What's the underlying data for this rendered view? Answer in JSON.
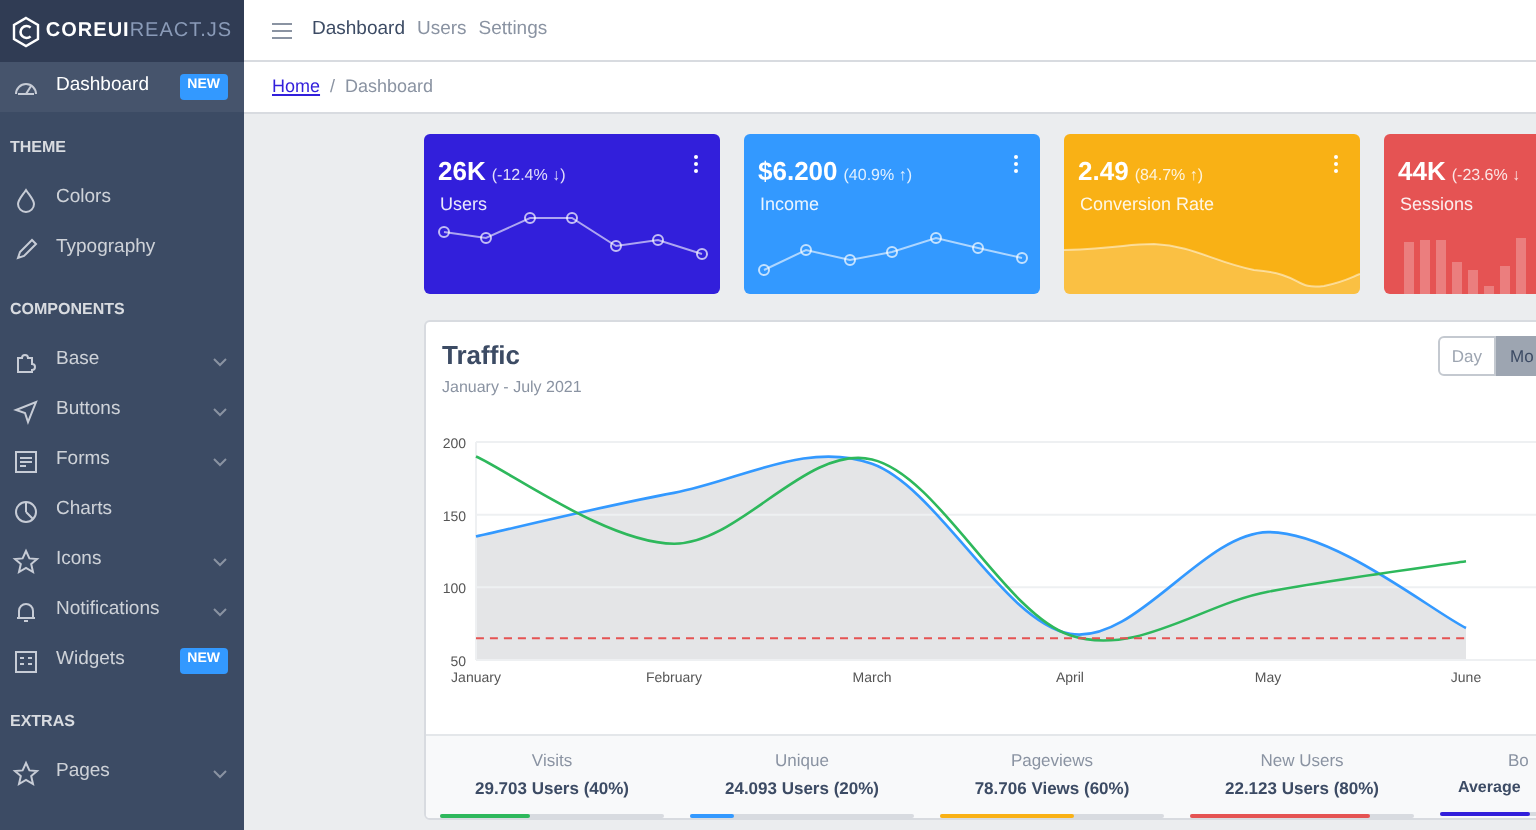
{
  "sidebar": {
    "brand": {
      "bold": "COREUI",
      "light": "REACT.JS"
    },
    "items": [
      {
        "kind": "link",
        "label": "Dashboard",
        "selected": true,
        "dropdown": false,
        "badge": "NEW"
      },
      {
        "kind": "title",
        "label": "THEME"
      },
      {
        "kind": "link",
        "label": "Colors",
        "selected": false,
        "dropdown": false
      },
      {
        "kind": "link",
        "label": "Typography",
        "selected": false,
        "dropdown": false
      },
      {
        "kind": "title",
        "label": "COMPONENTS"
      },
      {
        "kind": "link",
        "label": "Base",
        "selected": false,
        "dropdown": true
      },
      {
        "kind": "link",
        "label": "Buttons",
        "selected": false,
        "dropdown": true
      },
      {
        "kind": "link",
        "label": "Forms",
        "selected": false,
        "dropdown": true
      },
      {
        "kind": "link",
        "label": "Charts",
        "selected": false,
        "dropdown": false
      },
      {
        "kind": "link",
        "label": "Icons",
        "selected": false,
        "dropdown": true
      },
      {
        "kind": "link",
        "label": "Notifications",
        "selected": false,
        "dropdown": true
      },
      {
        "kind": "link",
        "label": "Widgets",
        "selected": false,
        "dropdown": false,
        "badge": "NEW"
      },
      {
        "kind": "title",
        "label": "EXTRAS"
      },
      {
        "kind": "link",
        "label": "Pages",
        "selected": false,
        "dropdown": true
      }
    ]
  },
  "header": {
    "nav": [
      {
        "label": "Dashboard",
        "selected": true
      },
      {
        "label": "Users",
        "selected": false
      },
      {
        "label": "Settings",
        "selected": false
      }
    ]
  },
  "breadcrumb": {
    "separator": "/",
    "items": [
      {
        "label": "Home",
        "kind": "link"
      },
      {
        "label": "Dashboard",
        "kind": "current"
      }
    ]
  },
  "cards": [
    {
      "value": "26K",
      "change": "(-12.4% ↓)",
      "label": "Users",
      "color": "#321fdb",
      "kind": "line"
    },
    {
      "value": "$6.200",
      "change": "(40.9% ↑)",
      "label": "Income",
      "color": "#3399ff",
      "kind": "line"
    },
    {
      "value": "2.49",
      "change": "(84.7% ↑)",
      "label": "Conversion Rate",
      "color": "#f9b115",
      "kind": "area"
    },
    {
      "value": "44K",
      "change": "(-23.6% ↓",
      "label": "Sessions",
      "color": "#e55353",
      "kind": "bar"
    }
  ],
  "traffic": {
    "title": "Traffic",
    "subtitle": "January - July 2021",
    "range_buttons": [
      {
        "label": "Day",
        "selected": false
      },
      {
        "label": "Mo",
        "selected": true
      }
    ],
    "chart_data": {
      "type": "line",
      "categories": [
        "January",
        "February",
        "March",
        "April",
        "May",
        "June"
      ],
      "ylim": [
        50,
        200
      ],
      "yticks": [
        50,
        100,
        150,
        200
      ],
      "series": [
        {
          "type": "area",
          "color": "#3399ff",
          "values": [
            135,
            165,
            185,
            68,
            138,
            72
          ]
        },
        {
          "color": "#2eb85c",
          "values": [
            190,
            130,
            188,
            67,
            97,
            118
          ]
        },
        {
          "color": "#e55353",
          "line_style": "dashed",
          "values": [
            65,
            65,
            65,
            65,
            65,
            65
          ]
        }
      ]
    },
    "stats": [
      {
        "label": "Visits",
        "value": "29.703 Users (40%)",
        "level": 0.4,
        "color": "#2eb85c"
      },
      {
        "label": "Unique",
        "value": "24.093 Users (20%)",
        "level": 0.2,
        "color": "#3399ff"
      },
      {
        "label": "Pageviews",
        "value": "78.706 Views (60%)",
        "level": 0.6,
        "color": "#f9b115"
      },
      {
        "label": "New Users",
        "value": "22.123 Users (80%)",
        "level": 0.8,
        "color": "#e55353"
      },
      {
        "label": "Bo",
        "value": "Average",
        "level": 0.4,
        "color": "#321fdb"
      }
    ]
  }
}
